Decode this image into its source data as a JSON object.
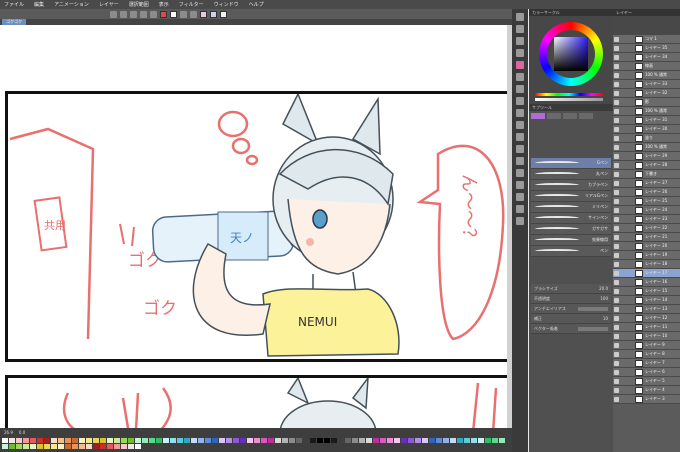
{
  "menu": {
    "items": [
      "ファイル",
      "編集",
      "アニメーション",
      "レイヤー",
      "選択範囲",
      "表示",
      "フィルター",
      "ウィンドウ",
      "ヘルプ"
    ]
  },
  "canvas": {
    "tab_label": "ゴクゴク",
    "sketch_words": {
      "bubble_tag": "共用",
      "sfx_1": "ゴク",
      "sfx_2": "ゴク",
      "speech": "ん〜〜？",
      "shirt_text": "NEMUI",
      "bottle_label": "天ノ"
    }
  },
  "status": {
    "zoom": "26.9",
    "rotation": "0.0"
  },
  "palette": {
    "colors": [
      "#ffffff",
      "#f5e6e6",
      "#f2c8c8",
      "#f29a9a",
      "#e85a5a",
      "#cc2e2e",
      "#a31f1f",
      "#f5dcc8",
      "#f2bc8f",
      "#e8935a",
      "#cc6b2e",
      "#f5f0c8",
      "#f2e68f",
      "#e8d45a",
      "#d9c22e",
      "#e6f5c8",
      "#c8ec8f",
      "#9ad95a",
      "#6bbf2e",
      "#c8f5d9",
      "#8fecb3",
      "#5ad98c",
      "#2ebf66",
      "#c8f0f5",
      "#8fe0ec",
      "#5acbd9",
      "#2ea9bf",
      "#c8d9f5",
      "#8fb3ec",
      "#5a8cd9",
      "#2e66bf",
      "#d9c8f5",
      "#b38fec",
      "#8c5ad9",
      "#662ebf",
      "#f5c8ec",
      "#ec8fd9",
      "#d95abf",
      "#bf2e9f",
      "#d9d9d9",
      "#b3b3b3",
      "#8c8c8c",
      "#666666",
      "#404040",
      "#1a1a1a",
      "#000000"
    ]
  },
  "color_panel": {
    "title": "カラーサークル",
    "accent": "#d96aa0"
  },
  "brush_panel": {
    "title": "サブツール",
    "brushes": [
      "Gペン",
      "丸ペン",
      "カブラペン",
      "リアルGペン",
      "ミリペン",
      "サインペン",
      "ガサガサ",
      "効果線用",
      "ペン"
    ],
    "properties": [
      {
        "label": "ブラシサイズ",
        "value": "20.0"
      },
      {
        "label": "不透明度",
        "value": "100"
      },
      {
        "label": "アンチエイリアス",
        "value": ""
      },
      {
        "label": "補正",
        "value": "10"
      },
      {
        "label": "ベクター吸着",
        "value": ""
      }
    ]
  },
  "layer_panel": {
    "title": "レイヤー",
    "layers": [
      {
        "name": "コマ 1",
        "selected": false
      },
      {
        "name": "レイヤー 35",
        "selected": false
      },
      {
        "name": "レイヤー 34",
        "selected": false
      },
      {
        "name": "線画",
        "selected": false
      },
      {
        "name": "100 % 通常",
        "selected": false
      },
      {
        "name": "レイヤー 33",
        "selected": false
      },
      {
        "name": "レイヤー 32",
        "selected": false
      },
      {
        "name": "影",
        "selected": false
      },
      {
        "name": "100 % 通常",
        "selected": false
      },
      {
        "name": "レイヤー 31",
        "selected": false
      },
      {
        "name": "レイヤー 30",
        "selected": false
      },
      {
        "name": "塗り",
        "selected": false
      },
      {
        "name": "100 % 通常",
        "selected": false
      },
      {
        "name": "レイヤー 29",
        "selected": false
      },
      {
        "name": "レイヤー 28",
        "selected": false
      },
      {
        "name": "下書き",
        "selected": false
      },
      {
        "name": "レイヤー 27",
        "selected": false
      },
      {
        "name": "レイヤー 26",
        "selected": false
      },
      {
        "name": "レイヤー 25",
        "selected": false
      },
      {
        "name": "レイヤー 24",
        "selected": false
      },
      {
        "name": "レイヤー 23",
        "selected": false
      },
      {
        "name": "レイヤー 22",
        "selected": false
      },
      {
        "name": "レイヤー 21",
        "selected": false
      },
      {
        "name": "レイヤー 20",
        "selected": false
      },
      {
        "name": "レイヤー 19",
        "selected": false
      },
      {
        "name": "レイヤー 18",
        "selected": false
      },
      {
        "name": "レイヤー 17",
        "selected": true
      },
      {
        "name": "レイヤー 16",
        "selected": false
      },
      {
        "name": "レイヤー 15",
        "selected": false
      },
      {
        "name": "レイヤー 14",
        "selected": false
      },
      {
        "name": "レイヤー 13",
        "selected": false
      },
      {
        "name": "レイヤー 12",
        "selected": false
      },
      {
        "name": "レイヤー 11",
        "selected": false
      },
      {
        "name": "レイヤー 10",
        "selected": false
      },
      {
        "name": "レイヤー 9",
        "selected": false
      },
      {
        "name": "レイヤー 8",
        "selected": false
      },
      {
        "name": "レイヤー 7",
        "selected": false
      },
      {
        "name": "レイヤー 6",
        "selected": false
      },
      {
        "name": "レイヤー 5",
        "selected": false
      },
      {
        "name": "レイヤー 4",
        "selected": false
      },
      {
        "name": "レイヤー 3",
        "selected": false
      }
    ]
  }
}
